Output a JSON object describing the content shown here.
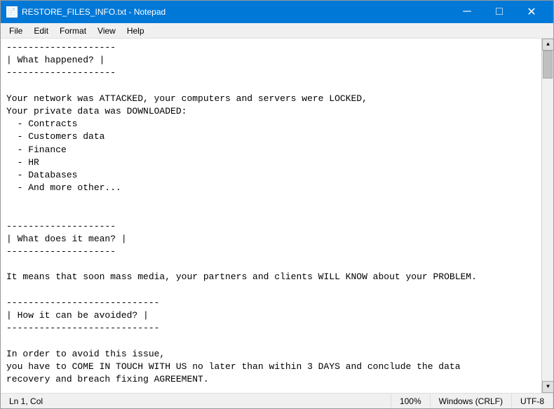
{
  "window": {
    "title": "RESTORE_FILES_INFO.txt - Notepad",
    "icon": "📄"
  },
  "title_buttons": {
    "minimize": "─",
    "maximize": "□",
    "close": "✕"
  },
  "menu": {
    "items": [
      "File",
      "Edit",
      "Format",
      "View",
      "Help"
    ]
  },
  "content": "--------------------\n| What happened? |\n--------------------\n\nYour network was ATTACKED, your computers and servers were LOCKED,\nYour private data was DOWNLOADED:\n  - Contracts\n  - Customers data\n  - Finance\n  - HR\n  - Databases\n  - And more other...\n\n\n--------------------\n| What does it mean? |\n--------------------\n\nIt means that soon mass media, your partners and clients WILL KNOW about your PROBLEM.\n\n----------------------------\n| How it can be avoided? |\n----------------------------\n\nIn order to avoid this issue,\nyou have to COME IN TOUCH WITH US no later than within 3 DAYS and conclude the data\nrecovery and breach fixing AGREEMENT.",
  "status": {
    "position": "Ln 1, Col",
    "zoom": "100%",
    "line_endings": "Windows (CRLF)",
    "encoding": "UTF-8"
  }
}
